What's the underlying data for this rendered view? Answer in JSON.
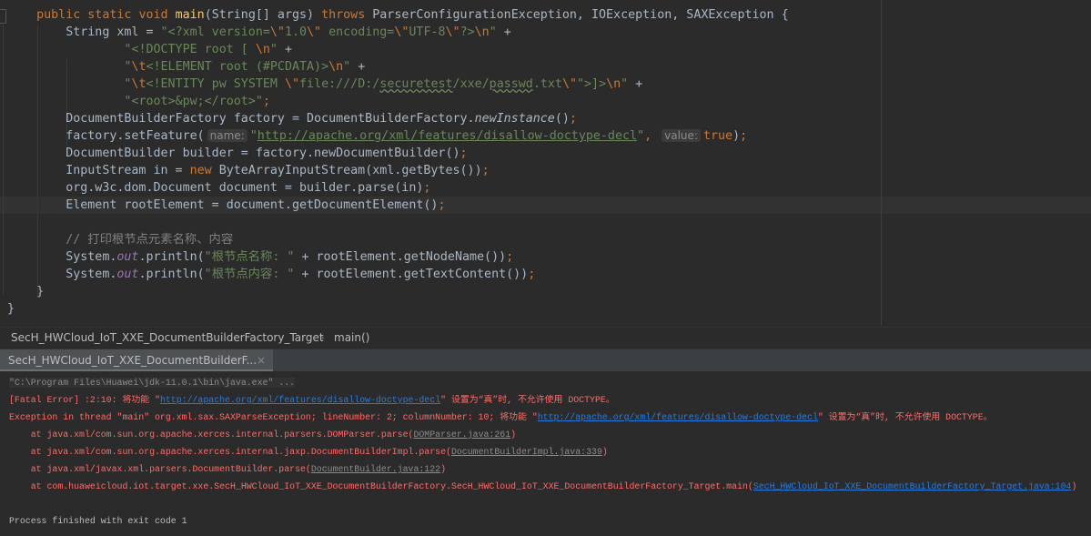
{
  "editor": {
    "current_line": 11,
    "lines": [
      [
        {
          "t": "    "
        },
        {
          "t": "public static void ",
          "c": "kw"
        },
        {
          "t": "main",
          "c": "fn"
        },
        {
          "t": "(String[] args) "
        },
        {
          "t": "throws ",
          "c": "kw"
        },
        {
          "t": "ParserConfigurationException, IOException, SAXException {"
        }
      ],
      [
        {
          "t": "        String xml = "
        },
        {
          "t": "\"<?xml version=",
          "c": "str"
        },
        {
          "t": "\\\"",
          "c": "esc"
        },
        {
          "t": "1.0",
          "c": "str"
        },
        {
          "t": "\\\"",
          "c": "esc"
        },
        {
          "t": " encoding=",
          "c": "str"
        },
        {
          "t": "\\\"",
          "c": "esc"
        },
        {
          "t": "UTF-8",
          "c": "str"
        },
        {
          "t": "\\\"",
          "c": "esc"
        },
        {
          "t": "?>",
          "c": "str"
        },
        {
          "t": "\\n",
          "c": "esc"
        },
        {
          "t": "\"",
          "c": "str"
        },
        {
          "t": " +"
        }
      ],
      [
        {
          "t": "                "
        },
        {
          "t": "\"<!DOCTYPE root [ ",
          "c": "str"
        },
        {
          "t": "\\n",
          "c": "esc"
        },
        {
          "t": "\"",
          "c": "str"
        },
        {
          "t": " +"
        }
      ],
      [
        {
          "t": "                "
        },
        {
          "t": "\"",
          "c": "str"
        },
        {
          "t": "\\t",
          "c": "esc"
        },
        {
          "t": "<!ELEMENT root (#PCDATA)>",
          "c": "str"
        },
        {
          "t": "\\n",
          "c": "esc"
        },
        {
          "t": "\"",
          "c": "str"
        },
        {
          "t": " +"
        }
      ],
      [
        {
          "t": "                "
        },
        {
          "t": "\"",
          "c": "str"
        },
        {
          "t": "\\t",
          "c": "esc"
        },
        {
          "t": "<!ENTITY pw SYSTEM ",
          "c": "str"
        },
        {
          "t": "\\\"",
          "c": "esc"
        },
        {
          "t": "file:///D:/",
          "c": "str"
        },
        {
          "t": "securetest",
          "c": "str typo"
        },
        {
          "t": "/xxe/",
          "c": "str"
        },
        {
          "t": "passwd",
          "c": "str typo"
        },
        {
          "t": ".txt",
          "c": "str"
        },
        {
          "t": "\\\"",
          "c": "esc"
        },
        {
          "t": "\">]>",
          "c": "str"
        },
        {
          "t": "\\n",
          "c": "esc"
        },
        {
          "t": "\"",
          "c": "str"
        },
        {
          "t": " +"
        }
      ],
      [
        {
          "t": "                "
        },
        {
          "t": "\"<root>&pw;</root>\"",
          "c": "str"
        },
        {
          "t": ";",
          "c": "kw"
        }
      ],
      [
        {
          "t": "        DocumentBuilderFactory factory = DocumentBuilderFactory."
        },
        {
          "t": "newInstance",
          "c": "it"
        },
        {
          "t": "()"
        },
        {
          "t": ";",
          "c": "kw"
        }
      ],
      [
        {
          "t": "        factory.setFeature("
        },
        {
          "t": "name:",
          "c": "hint"
        },
        {
          "t": "\"",
          "c": "str"
        },
        {
          "t": "http://apache.org/xml/features/disallow-doctype-decl",
          "c": "url"
        },
        {
          "t": "\"",
          "c": "str"
        },
        {
          "t": ", ",
          "c": "kw"
        },
        {
          "t": "value:",
          "c": "hint"
        },
        {
          "t": "true",
          "c": "kw"
        },
        {
          "t": ")"
        },
        {
          "t": ";",
          "c": "kw"
        }
      ],
      [
        {
          "t": "        DocumentBuilder builder = factory.newDocumentBuilder()"
        },
        {
          "t": ";",
          "c": "kw"
        }
      ],
      [
        {
          "t": "        InputStream in = "
        },
        {
          "t": "new ",
          "c": "kw"
        },
        {
          "t": "ByteArrayInputStream(xml.getBytes())"
        },
        {
          "t": ";",
          "c": "kw"
        }
      ],
      [
        {
          "t": "        org.w3c.dom.Document document = builder.parse(in)"
        },
        {
          "t": ";",
          "c": "kw"
        }
      ],
      [
        {
          "t": "        Element rootElement = document.getDocumentElement()"
        },
        {
          "t": ";",
          "c": "kw"
        }
      ],
      [
        {
          "t": ""
        }
      ],
      [
        {
          "t": "        "
        },
        {
          "t": "// 打印根节点元素名称、内容",
          "c": "cm"
        }
      ],
      [
        {
          "t": "        System."
        },
        {
          "t": "out",
          "c": "fld"
        },
        {
          "t": ".println("
        },
        {
          "t": "\"根节点名称: \"",
          "c": "str"
        },
        {
          "t": " + rootElement.getNodeName())"
        },
        {
          "t": ";",
          "c": "kw"
        }
      ],
      [
        {
          "t": "        System."
        },
        {
          "t": "out",
          "c": "fld"
        },
        {
          "t": ".println("
        },
        {
          "t": "\"根节点内容: \"",
          "c": "str"
        },
        {
          "t": " + rootElement.getTextContent())"
        },
        {
          "t": ";",
          "c": "kw"
        }
      ],
      [
        {
          "t": "    }"
        }
      ],
      [
        {
          "t": "}"
        }
      ]
    ]
  },
  "breadcrumb": {
    "class_name": "SecH_HWCloud_IoT_XXE_DocumentBuilderFactory_Target",
    "separator": "›",
    "method": "main()"
  },
  "run_tab": {
    "label": "SecH_HWCloud_IoT_XXE_DocumentBuilderF...",
    "close": "×"
  },
  "console": {
    "lines": [
      [
        {
          "t": "\"C:\\Program Files\\Huawei\\jdk-11.0.1\\bin\\java.exe\" ...",
          "c": "cmdline"
        }
      ],
      [
        {
          "t": "[Fatal Error] :2:10: 将功能 \""
        },
        {
          "t": "http://apache.org/xml/features/disallow-doctype-decl",
          "c": "lnk"
        },
        {
          "t": "\" 设置为“真”时, 不允许使用 DOCTYPE。"
        }
      ],
      [
        {
          "t": "Exception in thread \"main\" org.xml.sax.SAXParseException; lineNumber: 2; columnNumber: 10; 将功能 \""
        },
        {
          "t": "http://apache.org/xml/features/disallow-doctype-decl",
          "c": "lnk"
        },
        {
          "t": "\" 设置为“真”时, 不允许使用 DOCTYPE。"
        }
      ],
      [
        {
          "t": "    at java.xml/com.sun.org.apache.xerces.internal.parsers.DOMParser.parse("
        },
        {
          "t": "DOMParser.java:261",
          "c": "glnk"
        },
        {
          "t": ")"
        }
      ],
      [
        {
          "t": "    at java.xml/com.sun.org.apache.xerces.internal.jaxp.DocumentBuilderImpl.parse("
        },
        {
          "t": "DocumentBuilderImpl.java:339",
          "c": "glnk"
        },
        {
          "t": ")"
        }
      ],
      [
        {
          "t": "    at java.xml/javax.xml.parsers.DocumentBuilder.parse("
        },
        {
          "t": "DocumentBuilder.java:122",
          "c": "glnk"
        },
        {
          "t": ")"
        }
      ],
      [
        {
          "t": "    at com.huaweicloud.iot.target.xxe.SecH_HWCloud_IoT_XXE_DocumentBuilderFactory.SecH_HWCloud_IoT_XXE_DocumentBuilderFactory_Target.main("
        },
        {
          "t": "SecH_HWCloud_IoT_XXE_DocumentBuilderFactory_Target.java:104",
          "c": "lnk"
        },
        {
          "t": ")"
        }
      ],
      [
        {
          "t": ""
        }
      ],
      [
        {
          "t": "Process finished with exit code 1",
          "c": "wh"
        }
      ]
    ]
  },
  "colors": {
    "background": "#2b2b2b",
    "keyword": "#cc7832",
    "string": "#6a8759",
    "method_decl": "#ffc66d",
    "error": "#ff6b68",
    "link": "#287bde"
  }
}
